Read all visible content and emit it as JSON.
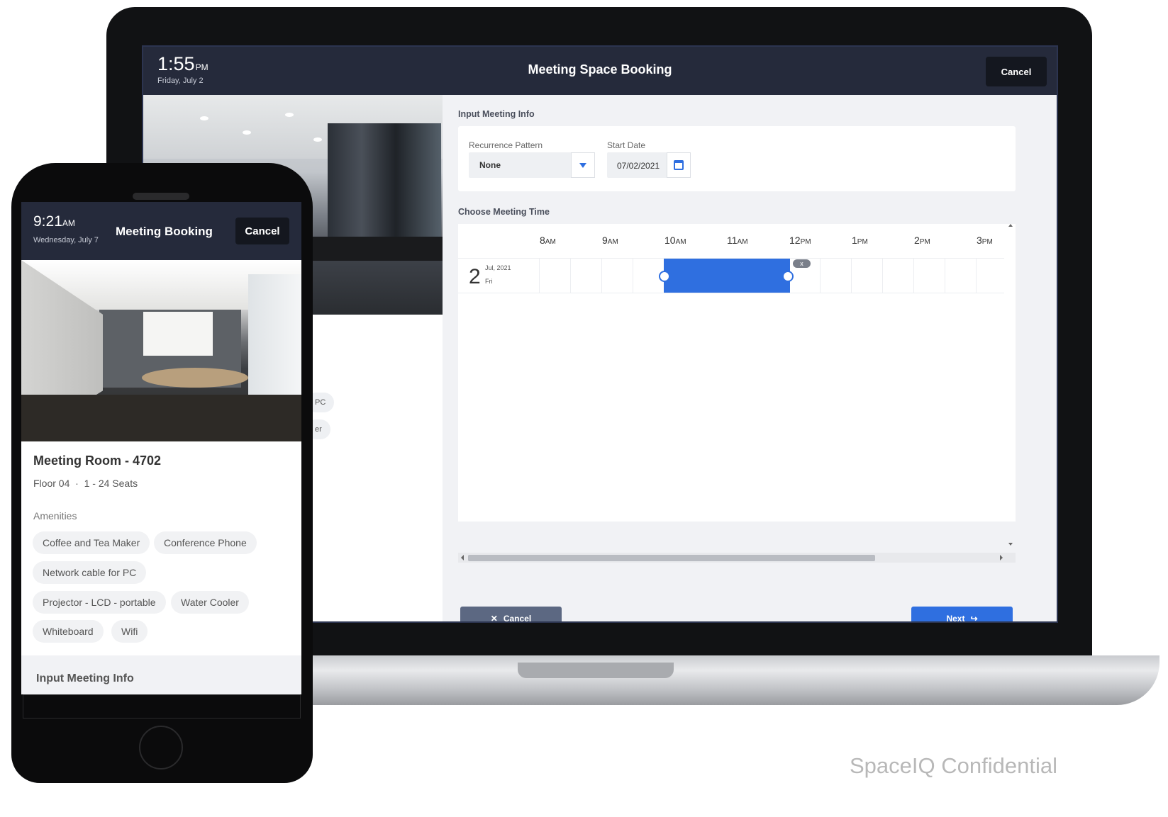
{
  "laptop": {
    "header": {
      "time": "1:55",
      "ampm": "PM",
      "date": "Friday, July 2",
      "title": "Meeting Space Booking",
      "cancel_label": "Cancel"
    },
    "chips_partial": [
      "PC",
      "er"
    ],
    "input_info": {
      "section_label": "Input Meeting Info",
      "recurrence_label": "Recurrence Pattern",
      "recurrence_value": "None",
      "start_date_label": "Start Date",
      "start_date_value": "07/02/2021"
    },
    "meeting_time": {
      "section_label": "Choose Meeting Time",
      "hours": [
        {
          "num": "8",
          "ap": "AM"
        },
        {
          "num": "9",
          "ap": "AM"
        },
        {
          "num": "10",
          "ap": "AM"
        },
        {
          "num": "11",
          "ap": "AM"
        },
        {
          "num": "12",
          "ap": "PM"
        },
        {
          "num": "1",
          "ap": "PM"
        },
        {
          "num": "2",
          "ap": "PM"
        },
        {
          "num": "3",
          "ap": "PM"
        }
      ],
      "day_number": "2",
      "day_month": "Jul, 2021",
      "day_weekday": "Fri",
      "remove_badge": "x"
    },
    "actions": {
      "cancel_label": "Cancel",
      "next_label": "Next"
    }
  },
  "phone": {
    "header": {
      "time": "9:21",
      "ampm": "AM",
      "date": "Wednesday, July 7",
      "title": "Meeting Booking",
      "cancel_label": "Cancel"
    },
    "room": {
      "name": "Meeting Room - 4702",
      "floor": "Floor 04",
      "separator": "·",
      "seats": "1 - 24 Seats"
    },
    "amenities_label": "Amenities",
    "amenities": [
      "Coffee and Tea Maker",
      "Conference Phone",
      "Network cable for PC",
      "Projector - LCD - portable",
      "Water Cooler",
      "Whiteboard",
      "Wifi"
    ],
    "input_section_label": "Input Meeting Info"
  },
  "footer": {
    "confidential": "SpaceIQ Confidential"
  },
  "colors": {
    "header_bg": "#252a3b",
    "accent": "#2f6fe0",
    "secondary_button": "#5c6882"
  }
}
